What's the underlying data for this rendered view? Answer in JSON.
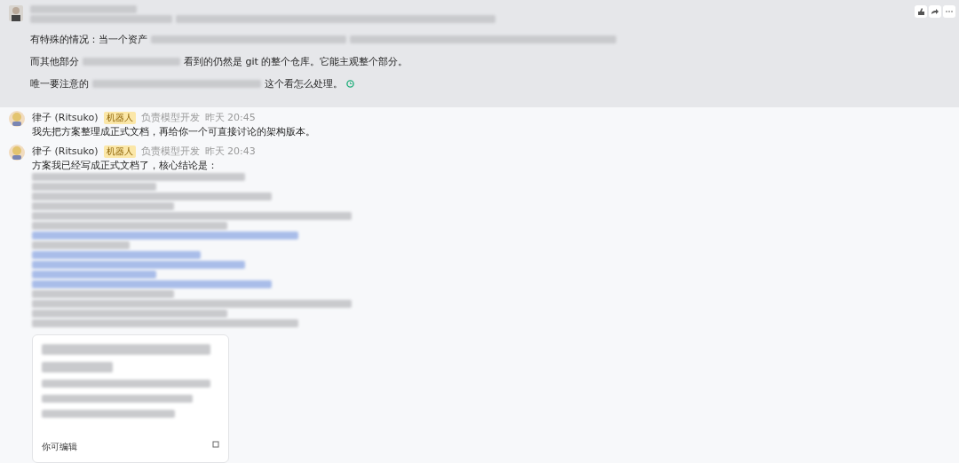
{
  "messages": [
    {
      "highlighted": true,
      "kind": "user",
      "lines": [
        [
          {
            "kind": "blur"
          },
          {
            "kind": "blur"
          }
        ],
        [
          {
            "kind": "text",
            "text": "有特殊的情况：当一个资产"
          },
          {
            "kind": "blur"
          },
          {
            "kind": "blur"
          }
        ],
        [
          {
            "kind": "text",
            "text": "而其他部分"
          },
          {
            "kind": "blur"
          },
          {
            "kind": "text",
            "text": "看到的仍然是 git 的整个仓库。它能主观整个部分。"
          }
        ],
        [
          {
            "kind": "text",
            "text": "唯一要注意的"
          },
          {
            "kind": "blur"
          },
          {
            "kind": "text",
            "text": "这个看怎么处理。"
          }
        ]
      ]
    },
    {
      "highlighted": false,
      "kind": "bot",
      "name": "律子 (Ritsuko)",
      "badge": "机器人",
      "role": "负责模型开发",
      "time": "昨天 20:45",
      "lines": [
        [
          {
            "kind": "text",
            "text": "我先把方案整理成正式文档，再给你一个可直接讨论的架构版本。"
          }
        ]
      ]
    },
    {
      "highlighted": false,
      "kind": "bot",
      "name": "律子 (Ritsuko)",
      "badge": "机器人",
      "role": "负责模型开发",
      "time": "昨天 20:43",
      "lines": [
        [
          {
            "kind": "text",
            "text": "方案我已经写成正式文档了，核心结论是："
          }
        ],
        [
          {
            "kind": "blur"
          }
        ],
        [
          {
            "kind": "blur"
          }
        ],
        [
          {
            "kind": "blur"
          }
        ],
        [
          {
            "kind": "blur"
          }
        ],
        [
          {
            "kind": "blur"
          }
        ],
        [
          {
            "kind": "blur"
          }
        ],
        [
          {
            "kind": "blur",
            "link": true
          }
        ],
        [
          {
            "kind": "blur"
          }
        ],
        [
          {
            "kind": "blur",
            "link": true
          }
        ],
        [
          {
            "kind": "blur",
            "link": true
          }
        ],
        [
          {
            "kind": "blur",
            "link": true
          }
        ],
        [
          {
            "kind": "blur",
            "link": true
          }
        ],
        [
          {
            "kind": "blur"
          }
        ],
        [
          {
            "kind": "blur"
          }
        ],
        [
          {
            "kind": "blur"
          }
        ],
        [
          {
            "kind": "blur"
          }
        ]
      ],
      "card": {
        "footer": "你可编辑"
      }
    }
  ]
}
